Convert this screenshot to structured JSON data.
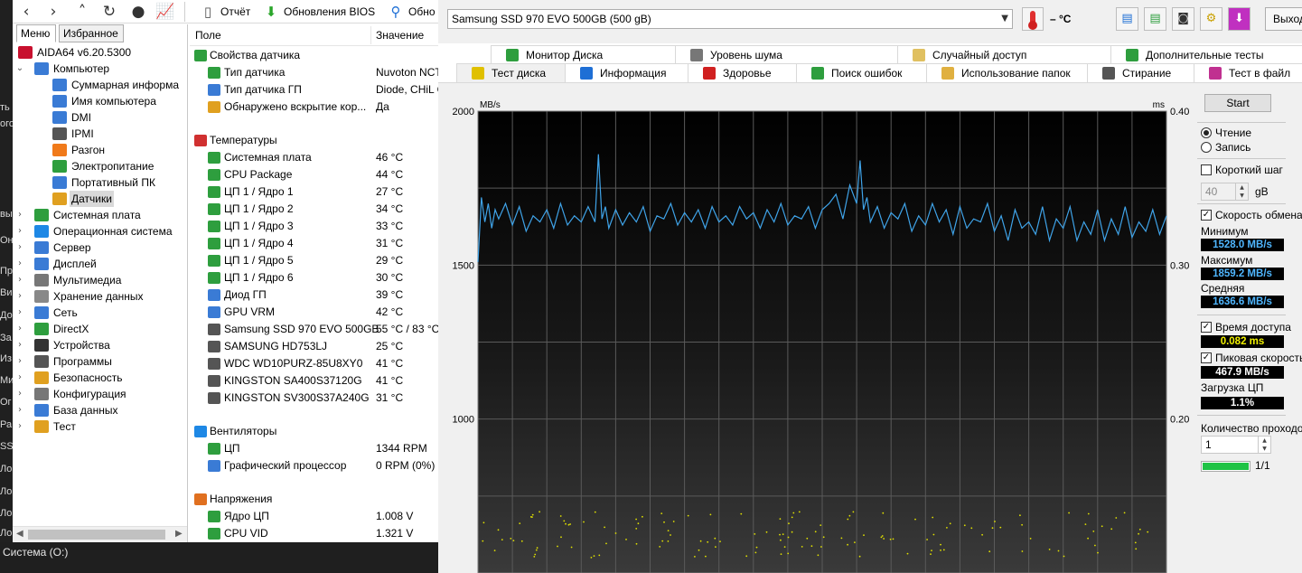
{
  "left_strip": {
    "chars": [
      "ть",
      "ого",
      "вы",
      "Оне",
      "Пр",
      "Ви",
      "До",
      "За",
      "Из",
      "Ми",
      "Ог",
      "Ра",
      "SS",
      "Ло",
      "Ло",
      "Ло",
      "Ло"
    ]
  },
  "aida": {
    "toolbar": {
      "report_label": "Отчёт",
      "bios_updates_label": "Обновления BIOS",
      "driver_updates_label": "Обно"
    },
    "nav": {
      "tabs": [
        "Меню",
        "Избранное"
      ],
      "tree": [
        {
          "label": "AIDA64 v6.20.5300",
          "indent": 0,
          "expander": "",
          "icon": "aida64-icon",
          "color": "#c8102e"
        },
        {
          "label": "Компьютер",
          "indent": 1,
          "expander": "v",
          "icon": "computer-icon",
          "color": "#3a7bd5"
        },
        {
          "label": "Суммарная информа",
          "indent": 2,
          "expander": "",
          "icon": "summary-icon",
          "color": "#3a7bd5"
        },
        {
          "label": "Имя компьютера",
          "indent": 2,
          "expander": "",
          "icon": "computer-name-icon",
          "color": "#3a7bd5"
        },
        {
          "label": "DMI",
          "indent": 2,
          "expander": "",
          "icon": "dmi-icon",
          "color": "#3a7bd5"
        },
        {
          "label": "IPMI",
          "indent": 2,
          "expander": "",
          "icon": "ipmi-icon",
          "color": "#555555"
        },
        {
          "label": "Разгон",
          "indent": 2,
          "expander": "",
          "icon": "overclock-icon",
          "color": "#f07a1a"
        },
        {
          "label": "Электропитание",
          "indent": 2,
          "expander": "",
          "icon": "power-icon",
          "color": "#2e9e3e"
        },
        {
          "label": "Портативный ПК",
          "indent": 2,
          "expander": "",
          "icon": "laptop-icon",
          "color": "#3a7bd5"
        },
        {
          "label": "Датчики",
          "indent": 2,
          "expander": "",
          "icon": "sensor-icon",
          "color": "#e0a020",
          "selected": true
        },
        {
          "label": "Системная плата",
          "indent": 1,
          "expander": ">",
          "icon": "motherboard-icon",
          "color": "#2e9e3e"
        },
        {
          "label": "Операционная система",
          "indent": 1,
          "expander": ">",
          "icon": "windows-icon",
          "color": "#1e88e5"
        },
        {
          "label": "Сервер",
          "indent": 1,
          "expander": ">",
          "icon": "server-icon",
          "color": "#3a7bd5"
        },
        {
          "label": "Дисплей",
          "indent": 1,
          "expander": ">",
          "icon": "display-icon",
          "color": "#3a7bd5"
        },
        {
          "label": "Мультимедиа",
          "indent": 1,
          "expander": ">",
          "icon": "multimedia-icon",
          "color": "#777777"
        },
        {
          "label": "Хранение данных",
          "indent": 1,
          "expander": ">",
          "icon": "storage-icon",
          "color": "#888888"
        },
        {
          "label": "Сеть",
          "indent": 1,
          "expander": ">",
          "icon": "network-icon",
          "color": "#3a7bd5"
        },
        {
          "label": "DirectX",
          "indent": 1,
          "expander": ">",
          "icon": "directx-icon",
          "color": "#2e9e3e"
        },
        {
          "label": "Устройства",
          "indent": 1,
          "expander": ">",
          "icon": "devices-icon",
          "color": "#333333"
        },
        {
          "label": "Программы",
          "indent": 1,
          "expander": ">",
          "icon": "programs-icon",
          "color": "#555555"
        },
        {
          "label": "Безопасность",
          "indent": 1,
          "expander": ">",
          "icon": "security-icon",
          "color": "#e0a020"
        },
        {
          "label": "Конфигурация",
          "indent": 1,
          "expander": ">",
          "icon": "config-icon",
          "color": "#777777"
        },
        {
          "label": "База данных",
          "indent": 1,
          "expander": ">",
          "icon": "database-icon",
          "color": "#3a7bd5"
        },
        {
          "label": "Тест",
          "indent": 1,
          "expander": ">",
          "icon": "test-icon",
          "color": "#e0a020"
        }
      ]
    },
    "sensor": {
      "col_field": "Поле",
      "col_value": "Значение",
      "rows": [
        {
          "type": "group",
          "field": "Свойства датчика",
          "value": "",
          "icon": "sensor-props-icon",
          "color": "#2e9e3e"
        },
        {
          "type": "item",
          "field": "Тип датчика",
          "value": "Nuvoton NCT",
          "icon": "sensor-type-icon",
          "color": "#2e9e3e"
        },
        {
          "type": "item",
          "field": "Тип датчика ГП",
          "value": "Diode, CHiL C",
          "icon": "gpu-sensor-icon",
          "color": "#3a7bd5"
        },
        {
          "type": "item",
          "field": "Обнаружено вскрытие кор...",
          "value": "Да",
          "icon": "shield-icon",
          "color": "#e0a020"
        },
        {
          "type": "spacer"
        },
        {
          "type": "group",
          "field": "Температуры",
          "value": "",
          "icon": "thermometer-icon",
          "color": "#d03030"
        },
        {
          "type": "item",
          "field": "Системная плата",
          "value": "46 °C",
          "icon": "motherboard-icon",
          "color": "#2e9e3e"
        },
        {
          "type": "item",
          "field": "CPU Package",
          "value": "44 °C",
          "icon": "cpu-icon",
          "color": "#2e9e3e"
        },
        {
          "type": "item",
          "field": "ЦП 1 / Ядро 1",
          "value": "27 °C",
          "icon": "cpu-icon",
          "color": "#2e9e3e"
        },
        {
          "type": "item",
          "field": "ЦП 1 / Ядро 2",
          "value": "34 °C",
          "icon": "cpu-icon",
          "color": "#2e9e3e"
        },
        {
          "type": "item",
          "field": "ЦП 1 / Ядро 3",
          "value": "33 °C",
          "icon": "cpu-icon",
          "color": "#2e9e3e"
        },
        {
          "type": "item",
          "field": "ЦП 1 / Ядро 4",
          "value": "31 °C",
          "icon": "cpu-icon",
          "color": "#2e9e3e"
        },
        {
          "type": "item",
          "field": "ЦП 1 / Ядро 5",
          "value": "29 °C",
          "icon": "cpu-icon",
          "color": "#2e9e3e"
        },
        {
          "type": "item",
          "field": "ЦП 1 / Ядро 6",
          "value": "30 °C",
          "icon": "cpu-icon",
          "color": "#2e9e3e"
        },
        {
          "type": "item",
          "field": "Диод ГП",
          "value": "39 °C",
          "icon": "gpu-icon",
          "color": "#3a7bd5"
        },
        {
          "type": "item",
          "field": "GPU VRM",
          "value": "42 °C",
          "icon": "gpu-icon",
          "color": "#3a7bd5"
        },
        {
          "type": "item",
          "field": "Samsung SSD 970 EVO 500GB",
          "value": "55 °C / 83 °C",
          "icon": "drive-icon",
          "color": "#555555"
        },
        {
          "type": "item",
          "field": "SAMSUNG HD753LJ",
          "value": "25 °C",
          "icon": "drive-icon",
          "color": "#555555"
        },
        {
          "type": "item",
          "field": "WDC WD10PURZ-85U8XY0",
          "value": "41 °C",
          "icon": "drive-icon",
          "color": "#555555"
        },
        {
          "type": "item",
          "field": "KINGSTON SA400S37120G",
          "value": "41 °C",
          "icon": "drive-icon",
          "color": "#555555"
        },
        {
          "type": "item",
          "field": "KINGSTON SV300S37A240G",
          "value": "31 °C",
          "icon": "drive-icon",
          "color": "#555555"
        },
        {
          "type": "spacer"
        },
        {
          "type": "group",
          "field": "Вентиляторы",
          "value": "",
          "icon": "fan-icon",
          "color": "#1e88e5"
        },
        {
          "type": "item",
          "field": "ЦП",
          "value": "1344 RPM",
          "icon": "cpu-icon",
          "color": "#2e9e3e"
        },
        {
          "type": "item",
          "field": "Графический процессор",
          "value": "0 RPM  (0%)",
          "icon": "gpu-icon",
          "color": "#3a7bd5"
        },
        {
          "type": "spacer"
        },
        {
          "type": "group",
          "field": "Напряжения",
          "value": "",
          "icon": "voltage-icon",
          "color": "#e07020"
        },
        {
          "type": "item",
          "field": "Ядро ЦП",
          "value": "1.008 V",
          "icon": "cpu-icon",
          "color": "#2e9e3e"
        },
        {
          "type": "item",
          "field": "CPU VID",
          "value": "1.321 V",
          "icon": "cpu-icon",
          "color": "#2e9e3e"
        }
      ]
    }
  },
  "status_bar": {
    "text": "Система (O:)"
  },
  "hdtune": {
    "drive": "Samsung SSD 970 EVO 500GB (500 gB)",
    "temperature": "– °C",
    "exit_label": "Выход",
    "tabs_row1": [
      {
        "label": "Монитор Диска",
        "icon": "monitor-icon",
        "color": "#2e9e3e"
      },
      {
        "label": "Уровень шума",
        "icon": "speaker-icon",
        "color": "#777777"
      },
      {
        "label": "Случайный доступ",
        "icon": "random-access-icon",
        "color": "#e0c060"
      },
      {
        "label": "Дополнительные тесты",
        "icon": "extra-tests-icon",
        "color": "#2e9e3e"
      }
    ],
    "tabs_row2": [
      {
        "label": "Тест диска",
        "icon": "bulb-icon",
        "color": "#e0c000",
        "active": true
      },
      {
        "label": "Информация",
        "icon": "info-icon",
        "color": "#1e6fd5"
      },
      {
        "label": "Здоровье",
        "icon": "health-icon",
        "color": "#d02020"
      },
      {
        "label": "Поиск ошибок",
        "icon": "magnifier-icon",
        "color": "#2e9e3e"
      },
      {
        "label": "Использование папок",
        "icon": "folder-icon",
        "color": "#e0b040"
      },
      {
        "label": "Стирание",
        "icon": "trash-icon",
        "color": "#555555"
      },
      {
        "label": "Тест в файл",
        "icon": "file-test-icon",
        "color": "#c03090"
      }
    ],
    "controls": {
      "start_label": "Start",
      "read_label": "Чтение",
      "write_label": "Запись",
      "short_stroke_label": "Короткий шаг",
      "short_stroke_value": "40",
      "short_stroke_unit": "gB",
      "transfer_rate_label": "Скорость обмена",
      "min_label": "Минимум",
      "min_value": "1528.0 MB/s",
      "max_label": "Максимум",
      "max_value": "1859.2 MB/s",
      "avg_label": "Средняя",
      "avg_value": "1636.6 MB/s",
      "access_time_label": "Время доступа",
      "access_time_value": "0.082 ms",
      "burst_label": "Пиковая скорость",
      "burst_value": "467.9 MB/s",
      "cpu_label": "Загрузка ЦП",
      "cpu_value": "1.1%",
      "passes_label": "Количество проходов",
      "passes_value": "1",
      "progress_text": "1/1",
      "progress_fraction": 1.0
    }
  },
  "chart_data": {
    "type": "line",
    "left_unit": "MB/s",
    "right_unit": "ms",
    "left_ticks": [
      "2000",
      "1500",
      "1000"
    ],
    "right_ticks": [
      "0.40",
      "0.30",
      "0.20"
    ],
    "ylim_left": [
      500,
      2000
    ],
    "ylim_right": [
      0.1,
      0.4
    ],
    "series": [
      {
        "color": "#3fa3e8",
        "x": [
          0,
          0.005,
          0.01,
          0.015,
          0.02,
          0.025,
          0.03,
          0.04,
          0.05,
          0.06,
          0.07,
          0.08,
          0.09,
          0.1,
          0.11,
          0.12,
          0.13,
          0.14,
          0.15,
          0.16,
          0.17,
          0.175,
          0.18,
          0.185,
          0.19,
          0.2,
          0.21,
          0.22,
          0.23,
          0.24,
          0.25,
          0.26,
          0.27,
          0.28,
          0.29,
          0.3,
          0.31,
          0.32,
          0.33,
          0.34,
          0.35,
          0.36,
          0.37,
          0.38,
          0.39,
          0.4,
          0.41,
          0.42,
          0.43,
          0.44,
          0.45,
          0.46,
          0.47,
          0.48,
          0.49,
          0.5,
          0.51,
          0.52,
          0.53,
          0.54,
          0.55,
          0.555,
          0.56,
          0.565,
          0.57,
          0.58,
          0.59,
          0.6,
          0.61,
          0.62,
          0.63,
          0.64,
          0.65,
          0.66,
          0.67,
          0.68,
          0.69,
          0.7,
          0.71,
          0.72,
          0.73,
          0.74,
          0.75,
          0.76,
          0.77,
          0.78,
          0.79,
          0.8,
          0.81,
          0.82,
          0.83,
          0.84,
          0.85,
          0.86,
          0.87,
          0.88,
          0.89,
          0.9,
          0.91,
          0.92,
          0.93,
          0.94,
          0.95,
          0.96,
          0.97,
          0.98,
          0.99,
          1.0
        ],
        "values": [
          1510,
          1720,
          1640,
          1700,
          1620,
          1680,
          1650,
          1700,
          1630,
          1690,
          1610,
          1660,
          1640,
          1680,
          1620,
          1700,
          1630,
          1660,
          1640,
          1690,
          1640,
          1860,
          1650,
          1690,
          1620,
          1680,
          1630,
          1670,
          1640,
          1690,
          1610,
          1660,
          1650,
          1700,
          1630,
          1670,
          1640,
          1680,
          1620,
          1690,
          1640,
          1660,
          1630,
          1690,
          1650,
          1670,
          1620,
          1680,
          1640,
          1700,
          1630,
          1660,
          1650,
          1690,
          1620,
          1680,
          1700,
          1730,
          1650,
          1760,
          1700,
          1840,
          1680,
          1720,
          1640,
          1690,
          1620,
          1670,
          1650,
          1700,
          1610,
          1660,
          1630,
          1700,
          1640,
          1680,
          1600,
          1690,
          1620,
          1650,
          1640,
          1700,
          1610,
          1660,
          1580,
          1680,
          1620,
          1640,
          1600,
          1690,
          1580,
          1650,
          1620,
          1690,
          1580,
          1640,
          1600,
          1680,
          1580,
          1650,
          1600,
          1690,
          1590,
          1640,
          1610,
          1680,
          1600,
          1660
        ]
      }
    ],
    "access_points_ms_range": [
      0.11,
      0.14
    ],
    "grid": true
  }
}
